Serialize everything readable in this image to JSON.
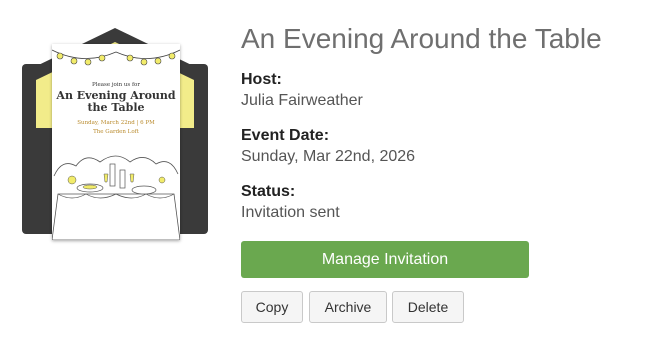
{
  "invitation": {
    "card_intro": "Please join us for",
    "card_title": "An Evening Around the Table",
    "card_date": "Sunday, March 22nd | 6 PM",
    "card_location": "The Garden Loft"
  },
  "event": {
    "title": "An Evening Around the Table",
    "host_label": "Host:",
    "host_value": "Julia Fairweather",
    "date_label": "Event Date:",
    "date_value": "Sunday, Mar 22nd, 2026",
    "status_label": "Status:",
    "status_value": "Invitation sent"
  },
  "actions": {
    "manage_label": "Manage Invitation",
    "copy_label": "Copy",
    "archive_label": "Archive",
    "delete_label": "Delete"
  },
  "colors": {
    "manage_button": "#6aa84f",
    "envelope": "#3a3a3a",
    "envelope_liner": "#f2ec8a"
  }
}
